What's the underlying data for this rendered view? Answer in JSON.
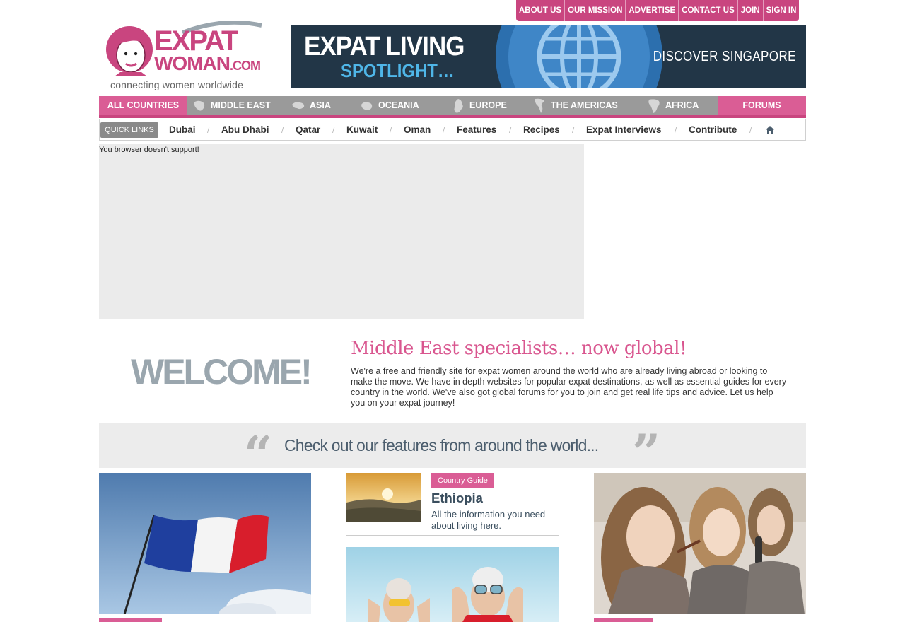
{
  "top_links": [
    "ABOUT US",
    "OUR MISSION",
    "ADVERTISE",
    "CONTACT US",
    "JOIN",
    "SIGN IN"
  ],
  "logo": {
    "line1": "EXPAT",
    "line2": "WOMAN",
    "line2_suffix": ".COM",
    "tagline": "connecting women worldwide"
  },
  "banner": {
    "headline": "EXPAT LIVING",
    "subline": "SPOTLIGHT…",
    "cta": "DISCOVER SINGAPORE"
  },
  "main_nav": {
    "all": "ALL COUNTRIES",
    "regions": [
      "MIDDLE EAST",
      "ASIA",
      "OCEANIA",
      "EUROPE",
      "THE AMERICAS",
      "AFRICA"
    ],
    "forums": "FORUMS"
  },
  "quick_links": {
    "label": "QUICK LINKS",
    "items": [
      "Dubai",
      "Abu Dhabi",
      "Qatar",
      "Kuwait",
      "Oman",
      "Features",
      "Recipes",
      "Expat Interviews",
      "Contribute"
    ]
  },
  "video": {
    "message": "You browser doesn't support!"
  },
  "welcome": {
    "heading": "WELCOME!",
    "title": "Middle East specialists… now global!",
    "body": "We're a free and friendly site for expat women around the world who are already living abroad or looking to make the move. We have in depth websites for popular expat destinations, as well as essential guides for every country in the world. We've also got global forums for you to join and get real life tips and advice. Let us help you on your expat journey!"
  },
  "features_strip": {
    "text": "Check out our features from around the world..."
  },
  "cards": {
    "ethiopia": {
      "tag": "Country Guide",
      "title": "Ethiopia",
      "desc": "All the information you need about living here."
    }
  },
  "colors": {
    "brand_pink": "#c9457f",
    "nav_pink": "#da5d95",
    "slate": "#3a4e5e"
  }
}
